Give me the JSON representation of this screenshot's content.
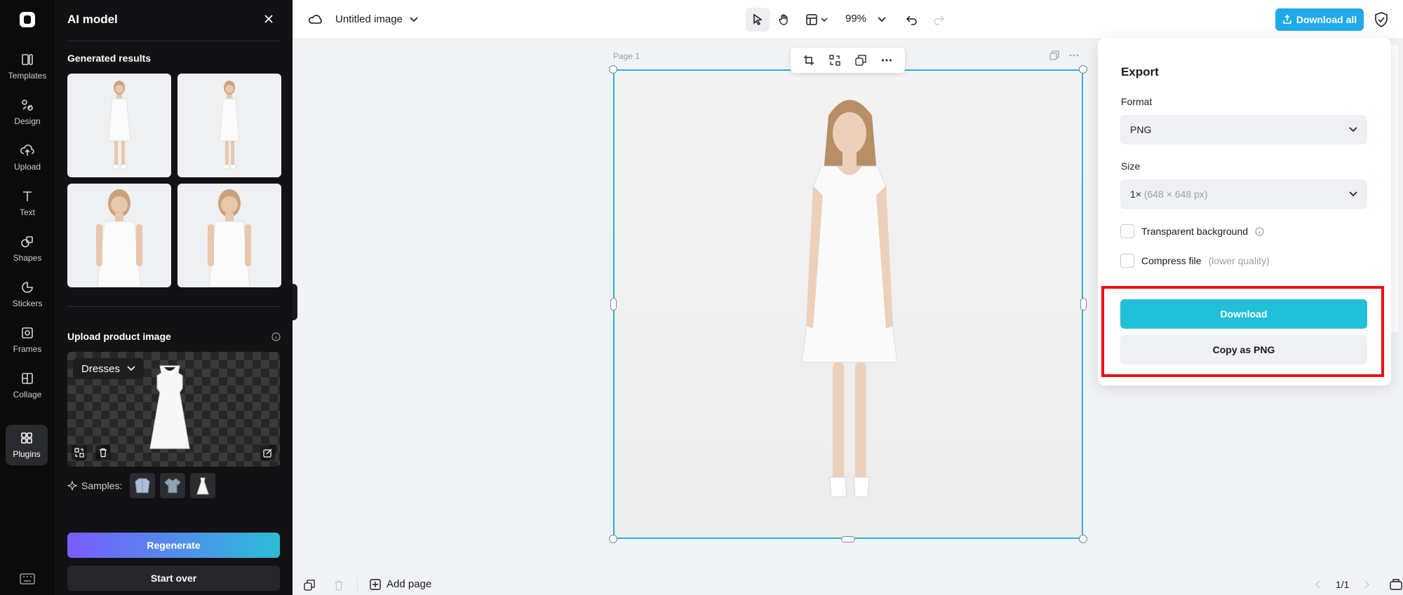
{
  "rail": {
    "items": [
      {
        "label": "Templates",
        "icon": "templates-icon"
      },
      {
        "label": "Design",
        "icon": "design-icon"
      },
      {
        "label": "Upload",
        "icon": "upload-icon"
      },
      {
        "label": "Text",
        "icon": "text-icon"
      },
      {
        "label": "Shapes",
        "icon": "shapes-icon"
      },
      {
        "label": "Stickers",
        "icon": "stickers-icon"
      },
      {
        "label": "Frames",
        "icon": "frames-icon"
      },
      {
        "label": "Collage",
        "icon": "collage-icon"
      },
      {
        "label": "Plugins",
        "icon": "plugins-icon"
      }
    ],
    "active": "Plugins"
  },
  "panel": {
    "title": "AI model",
    "generated_title": "Generated results",
    "upload_title": "Upload product image",
    "category": "Dresses",
    "samples_label": "Samples:",
    "regenerate": "Regenerate",
    "start_over": "Start over"
  },
  "topbar": {
    "doc_title": "Untitled image",
    "zoom": "99%",
    "download_all": "Download all"
  },
  "canvas": {
    "page_label": "Page 1"
  },
  "bottombar": {
    "add_page": "Add page",
    "pager": "1/1"
  },
  "export": {
    "title": "Export",
    "format_label": "Format",
    "format_value": "PNG",
    "size_label": "Size",
    "size_value": "1×",
    "size_detail": "(648 × 648 px)",
    "transparent_label": "Transparent background",
    "compress_label": "Compress file",
    "compress_note": "(lower quality)",
    "download": "Download",
    "copy": "Copy as PNG"
  },
  "colors": {
    "accent": "#22c0d8",
    "download_all": "#1fa9e9",
    "highlight": "#ee1111",
    "selection": "#22b6d8"
  }
}
